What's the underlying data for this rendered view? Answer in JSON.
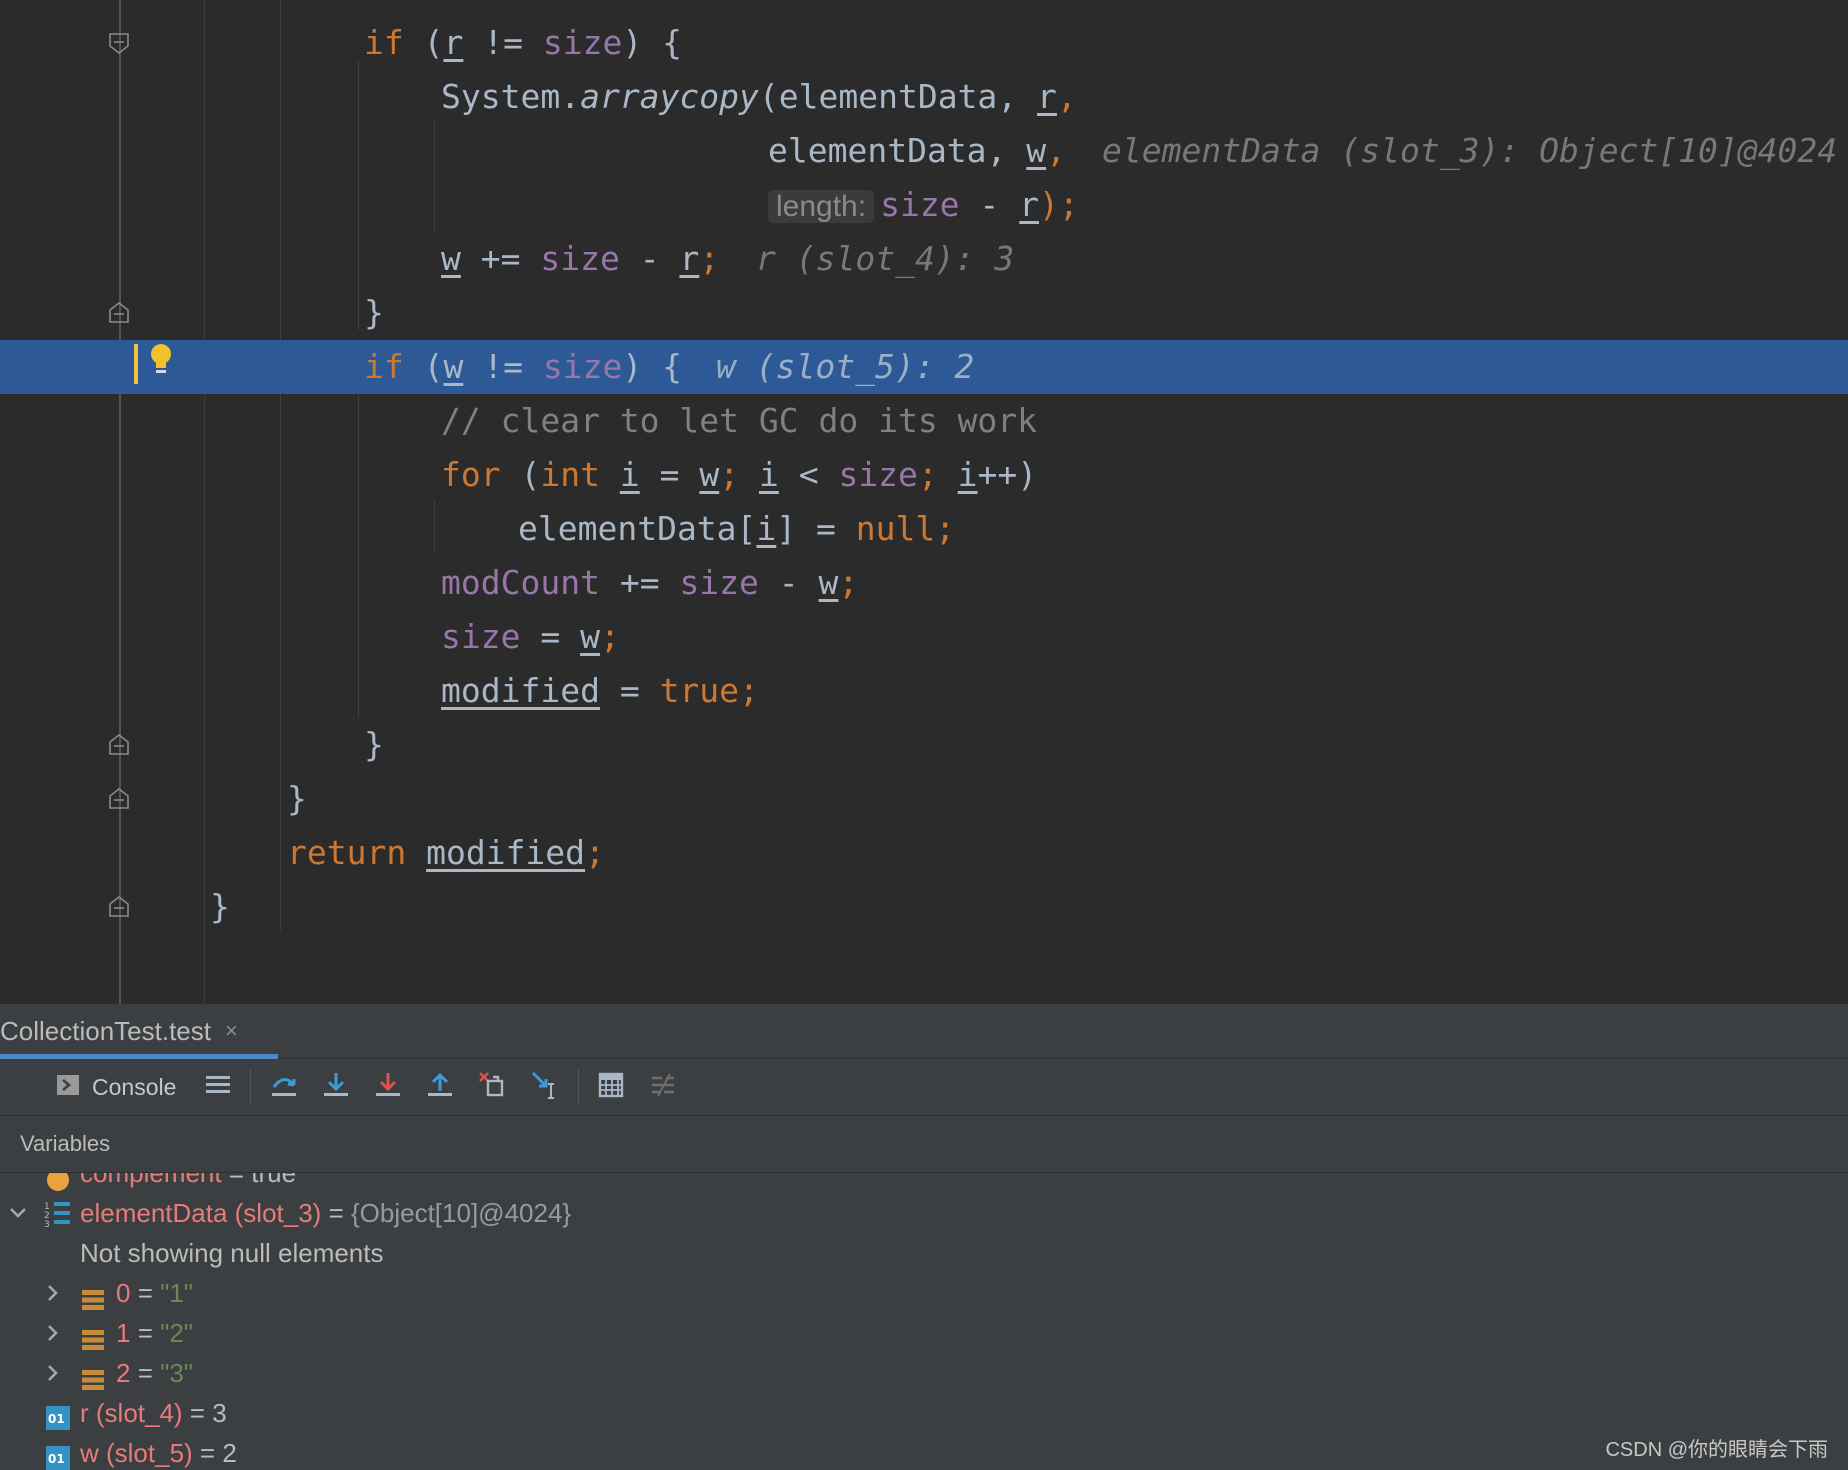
{
  "editor": {
    "lines": {
      "l1": {
        "kw": "if",
        "open": " (",
        "var": "r",
        "op": " != ",
        "fld": "size",
        "close": ") {"
      },
      "l2": {
        "cls": "System.",
        "mth": "arraycopy",
        "args": "(elementData, ",
        "var": "r",
        "comma": ","
      },
      "l3": {
        "arg": "elementData, ",
        "var": "w",
        "comma": ",",
        "hint": "elementData (slot_3): Object[10]@4024"
      },
      "l4": {
        "param_hint": "length:",
        "fld": "size",
        "op": " - ",
        "var": "r",
        "close": ");"
      },
      "l5": {
        "var": "w",
        "op": " += ",
        "fld": "size",
        "op2": " - ",
        "var2": "r",
        "semi": ";",
        "hint": "r (slot_4): 3"
      },
      "l6": {
        "text": "}"
      },
      "l7": {
        "kw": "if",
        "open": " (",
        "var": "w",
        "op": " != ",
        "fld": "size",
        "close": ") {",
        "hint": "w (slot_5): 2"
      },
      "l8": {
        "text": "// clear to let GC do its work"
      },
      "l9": {
        "kw": "for",
        "open": " (",
        "kw2": "int",
        "sp": " ",
        "var": "i",
        "eq": " = ",
        "var2": "w",
        "semi": "; ",
        "var3": "i",
        "lt": " < ",
        "fld": "size",
        "semi2": "; ",
        "var4": "i",
        "inc": "++)"
      },
      "l10": {
        "pre": "elementData[",
        "var": "i",
        "post": "] = ",
        "kw": "null",
        "semi": ";"
      },
      "l11": {
        "fld": "modCount",
        "op": " += ",
        "fld2": "size",
        "op2": " - ",
        "var": "w",
        "semi": ";"
      },
      "l12": {
        "fld": "size",
        "eq": " = ",
        "var": "w",
        "semi": ";"
      },
      "l13": {
        "var": "modified",
        "eq": " = ",
        "kw": "true",
        "semi": ";"
      },
      "l14": {
        "text": "}"
      },
      "l15": {
        "text": "}"
      },
      "l16": {
        "kw": "return",
        "sp": " ",
        "var": "modified",
        "semi": ";"
      },
      "l17": {
        "text": "}"
      }
    }
  },
  "debug": {
    "tab_title": "CollectionTest.test",
    "tab_close": "×",
    "console_label": "Console",
    "variables_title": "Variables",
    "variables": {
      "partial": {
        "name": "complement",
        "value": " = true"
      },
      "elementData": {
        "name": "elementData (slot_3)",
        "eq": " = ",
        "value": "{Object[10]@4024}"
      },
      "note": "Not showing null elements",
      "items": [
        {
          "index": "0",
          "eq": " = ",
          "value": "\"1\""
        },
        {
          "index": "1",
          "eq": " = ",
          "value": "\"2\""
        },
        {
          "index": "2",
          "eq": " = ",
          "value": "\"3\""
        }
      ],
      "r": {
        "name": "r (slot_4)",
        "value": " = 3",
        "icon_text": "01"
      },
      "w": {
        "name": "w (slot_5)",
        "value": " = 2",
        "icon_text": "01"
      }
    }
  },
  "watermark": "CSDN @你的眼睛会下雨",
  "colors": {
    "editor_bg": "#2b2b2b",
    "current_line": "#2d5a96",
    "keyword": "#cc7832",
    "field": "#9876aa",
    "string": "#6a8759",
    "var_name": "#e77b79",
    "panel_bg": "#3c3f41",
    "accent": "#4a88c7"
  }
}
